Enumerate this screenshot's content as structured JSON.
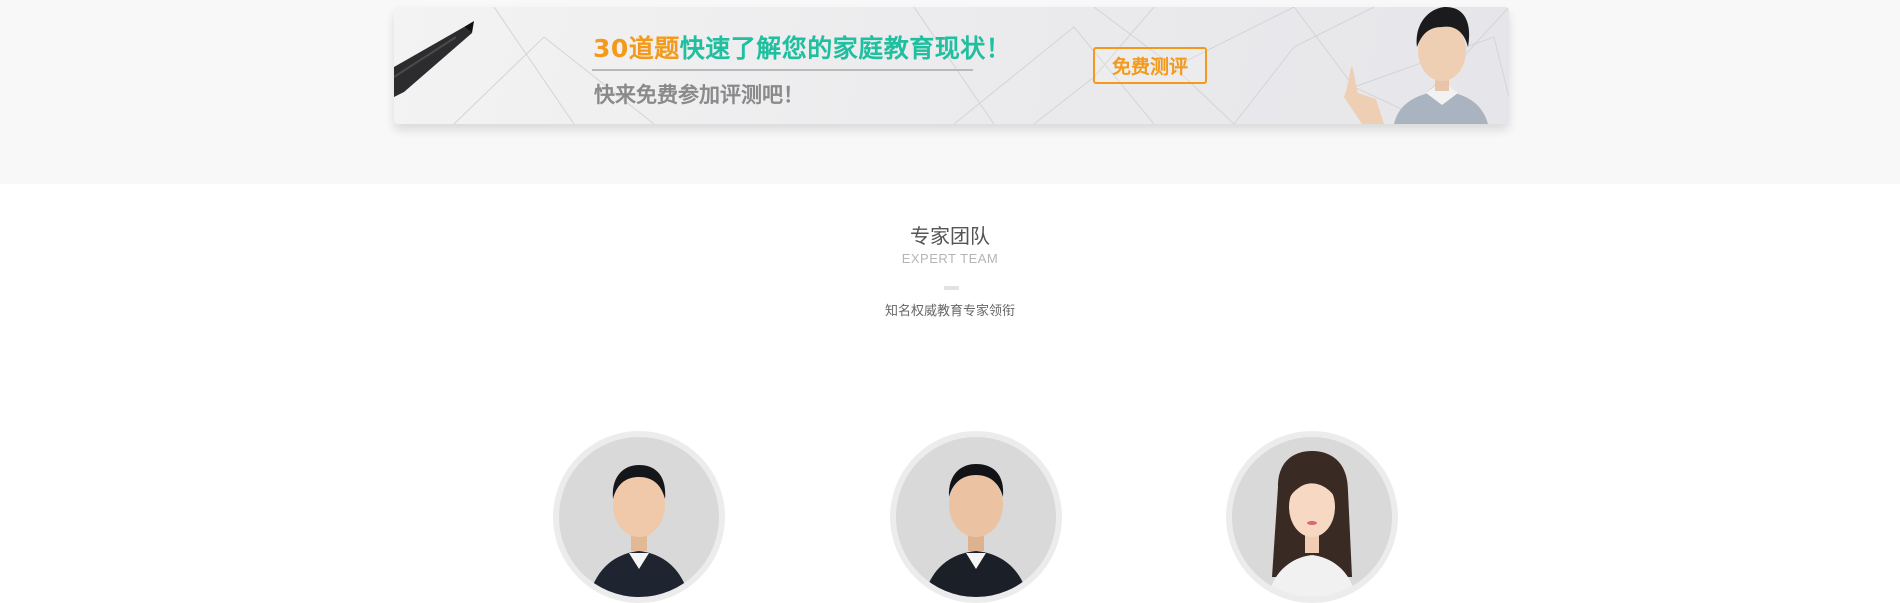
{
  "banner": {
    "title_highlight": "30道题",
    "title_main": "快速了解您的家庭教育现状！",
    "subtitle": "快来免费参加评测吧！",
    "cta_label": "免费测评",
    "colors": {
      "highlight": "#f39a1c",
      "main": "#1fbf9f",
      "subtitle": "#8a8a8a"
    }
  },
  "expert_section": {
    "title": "专家团队",
    "subtitle": "EXPERT TEAM",
    "description": "知名权威教育专家领衔"
  },
  "experts": [
    {
      "icon": "expert-photo-male-1"
    },
    {
      "icon": "expert-photo-male-2"
    },
    {
      "icon": "expert-photo-female-1"
    }
  ]
}
